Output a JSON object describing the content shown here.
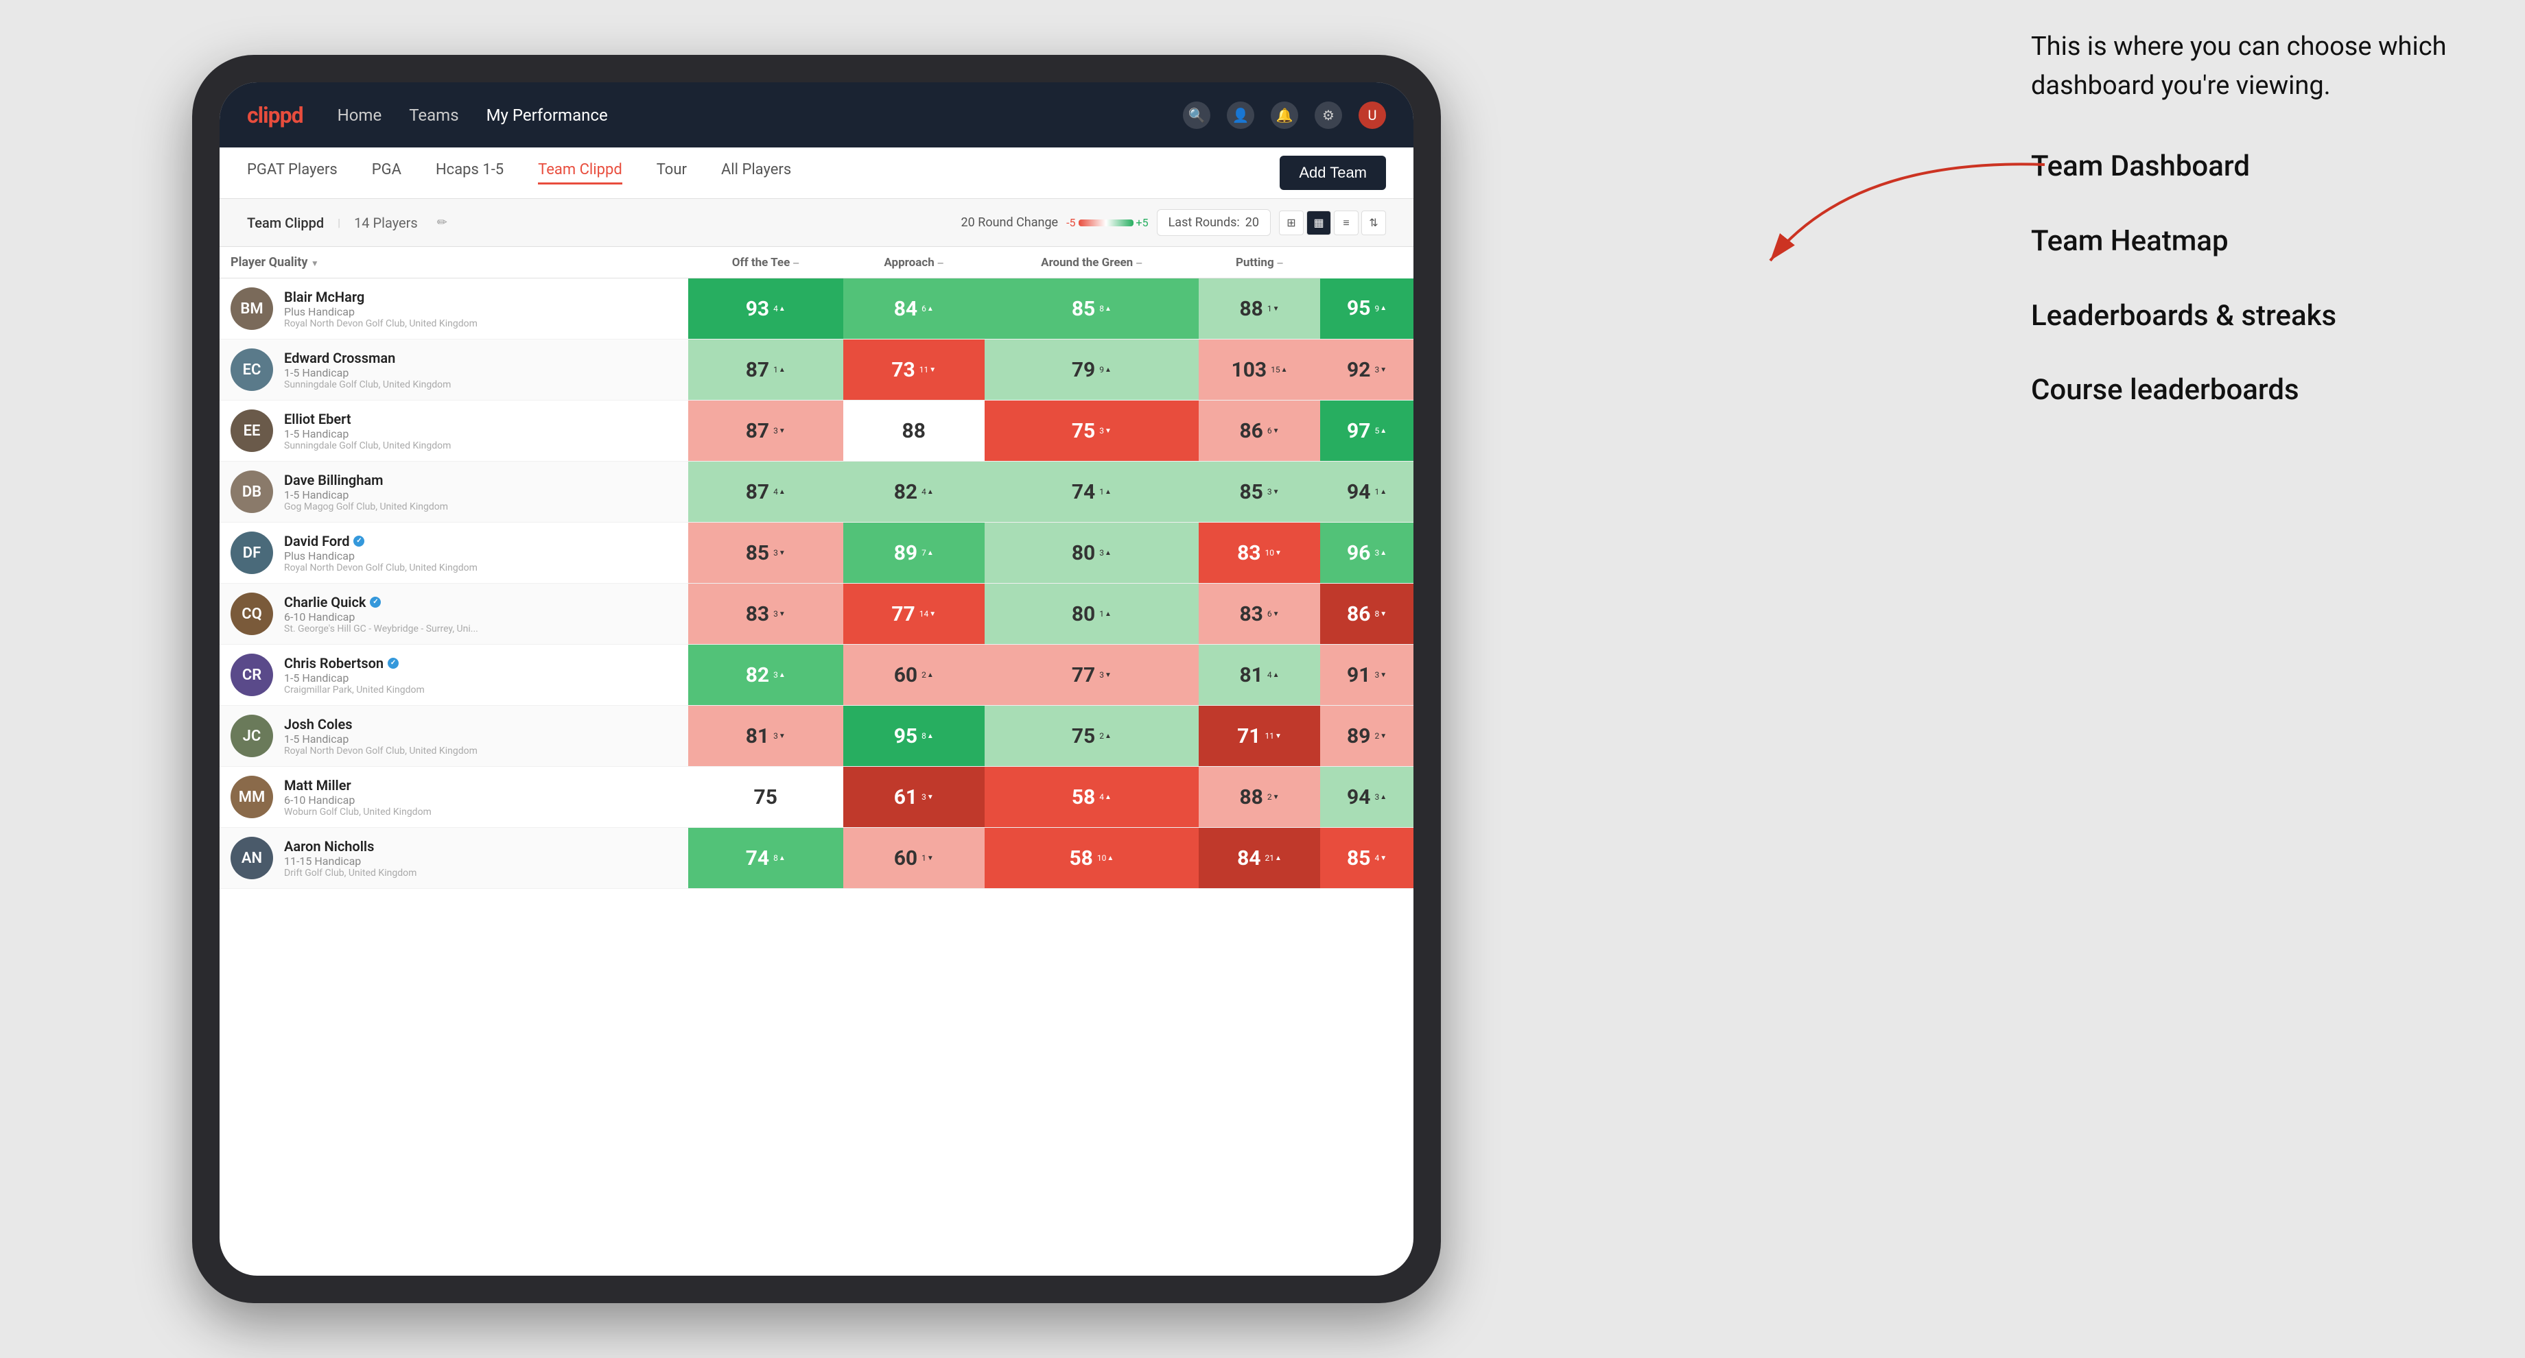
{
  "annotation": {
    "intro": "This is where you can choose which dashboard you're viewing.",
    "items": [
      "Team Dashboard",
      "Team Heatmap",
      "Leaderboards & streaks",
      "Course leaderboards"
    ]
  },
  "nav": {
    "logo": "clippd",
    "links": [
      "Home",
      "Teams",
      "My Performance"
    ],
    "activeLink": "My Performance"
  },
  "tabs": {
    "items": [
      "PGAT Players",
      "PGA",
      "Hcaps 1-5",
      "Team Clippd",
      "Tour",
      "All Players"
    ],
    "active": "Team Clippd",
    "addTeamLabel": "Add Team"
  },
  "controls": {
    "teamName": "Team Clippd",
    "playerCount": "14 Players",
    "roundChangeLabel": "20 Round Change",
    "scaleMin": "-5",
    "scaleMax": "+5",
    "lastRoundsLabel": "Last Rounds:",
    "lastRoundsValue": "20"
  },
  "tableHeaders": {
    "playerQuality": "Player Quality",
    "offTee": "Off the Tee",
    "approach": "Approach",
    "aroundGreen": "Around the Green",
    "putting": "Putting"
  },
  "players": [
    {
      "name": "Blair McHarg",
      "handicap": "Plus Handicap",
      "club": "Royal North Devon Golf Club, United Kingdom",
      "initials": "BM",
      "avatarColor": "#7a6a5a",
      "playerQuality": {
        "score": 93,
        "change": 4,
        "dir": "up",
        "bg": "bg-green-dark"
      },
      "offTee": {
        "score": 84,
        "change": 6,
        "dir": "up",
        "bg": "bg-green-mid"
      },
      "approach": {
        "score": 85,
        "change": 8,
        "dir": "up",
        "bg": "bg-green-mid"
      },
      "aroundGreen": {
        "score": 88,
        "change": 1,
        "dir": "down",
        "bg": "bg-green-light"
      },
      "putting": {
        "score": 95,
        "change": 9,
        "dir": "up",
        "bg": "bg-green-dark"
      }
    },
    {
      "name": "Edward Crossman",
      "handicap": "1-5 Handicap",
      "club": "Sunningdale Golf Club, United Kingdom",
      "initials": "EC",
      "avatarColor": "#5a7a8a",
      "playerQuality": {
        "score": 87,
        "change": 1,
        "dir": "up",
        "bg": "bg-green-light"
      },
      "offTee": {
        "score": 73,
        "change": 11,
        "dir": "down",
        "bg": "bg-red-mid"
      },
      "approach": {
        "score": 79,
        "change": 9,
        "dir": "up",
        "bg": "bg-green-light"
      },
      "aroundGreen": {
        "score": 103,
        "change": 15,
        "dir": "up",
        "bg": "bg-red-light"
      },
      "putting": {
        "score": 92,
        "change": 3,
        "dir": "down",
        "bg": "bg-red-light"
      }
    },
    {
      "name": "Elliot Ebert",
      "handicap": "1-5 Handicap",
      "club": "Sunningdale Golf Club, United Kingdom",
      "initials": "EE",
      "avatarColor": "#6a5a4a",
      "playerQuality": {
        "score": 87,
        "change": 3,
        "dir": "down",
        "bg": "bg-red-light"
      },
      "offTee": {
        "score": 88,
        "change": null,
        "dir": null,
        "bg": "bg-white"
      },
      "approach": {
        "score": 75,
        "change": 3,
        "dir": "down",
        "bg": "bg-red-mid"
      },
      "aroundGreen": {
        "score": 86,
        "change": 6,
        "dir": "down",
        "bg": "bg-red-light"
      },
      "putting": {
        "score": 97,
        "change": 5,
        "dir": "up",
        "bg": "bg-green-dark"
      }
    },
    {
      "name": "Dave Billingham",
      "handicap": "1-5 Handicap",
      "club": "Gog Magog Golf Club, United Kingdom",
      "initials": "DB",
      "avatarColor": "#8a7a6a",
      "playerQuality": {
        "score": 87,
        "change": 4,
        "dir": "up",
        "bg": "bg-green-light"
      },
      "offTee": {
        "score": 82,
        "change": 4,
        "dir": "up",
        "bg": "bg-green-light"
      },
      "approach": {
        "score": 74,
        "change": 1,
        "dir": "up",
        "bg": "bg-green-light"
      },
      "aroundGreen": {
        "score": 85,
        "change": 3,
        "dir": "down",
        "bg": "bg-green-light"
      },
      "putting": {
        "score": 94,
        "change": 1,
        "dir": "up",
        "bg": "bg-green-light"
      }
    },
    {
      "name": "David Ford",
      "handicap": "Plus Handicap",
      "club": "Royal North Devon Golf Club, United Kingdom",
      "initials": "DF",
      "avatarColor": "#4a6a7a",
      "badge": true,
      "playerQuality": {
        "score": 85,
        "change": 3,
        "dir": "down",
        "bg": "bg-red-light"
      },
      "offTee": {
        "score": 89,
        "change": 7,
        "dir": "up",
        "bg": "bg-green-mid"
      },
      "approach": {
        "score": 80,
        "change": 3,
        "dir": "up",
        "bg": "bg-green-light"
      },
      "aroundGreen": {
        "score": 83,
        "change": 10,
        "dir": "down",
        "bg": "bg-red-mid"
      },
      "putting": {
        "score": 96,
        "change": 3,
        "dir": "up",
        "bg": "bg-green-mid"
      }
    },
    {
      "name": "Charlie Quick",
      "handicap": "6-10 Handicap",
      "club": "St. George's Hill GC - Weybridge - Surrey, Uni...",
      "initials": "CQ",
      "avatarColor": "#7a5a3a",
      "badge": true,
      "playerQuality": {
        "score": 83,
        "change": 3,
        "dir": "down",
        "bg": "bg-red-light"
      },
      "offTee": {
        "score": 77,
        "change": 14,
        "dir": "down",
        "bg": "bg-red-mid"
      },
      "approach": {
        "score": 80,
        "change": 1,
        "dir": "up",
        "bg": "bg-green-light"
      },
      "aroundGreen": {
        "score": 83,
        "change": 6,
        "dir": "down",
        "bg": "bg-red-light"
      },
      "putting": {
        "score": 86,
        "change": 8,
        "dir": "down",
        "bg": "bg-red-dark"
      }
    },
    {
      "name": "Chris Robertson",
      "handicap": "1-5 Handicap",
      "club": "Craigmillar Park, United Kingdom",
      "initials": "CR",
      "avatarColor": "#5a4a8a",
      "badge": true,
      "playerQuality": {
        "score": 82,
        "change": 3,
        "dir": "up",
        "bg": "bg-green-mid"
      },
      "offTee": {
        "score": 60,
        "change": 2,
        "dir": "up",
        "bg": "bg-red-light"
      },
      "approach": {
        "score": 77,
        "change": 3,
        "dir": "down",
        "bg": "bg-red-light"
      },
      "aroundGreen": {
        "score": 81,
        "change": 4,
        "dir": "up",
        "bg": "bg-green-light"
      },
      "putting": {
        "score": 91,
        "change": 3,
        "dir": "down",
        "bg": "bg-red-light"
      }
    },
    {
      "name": "Josh Coles",
      "handicap": "1-5 Handicap",
      "club": "Royal North Devon Golf Club, United Kingdom",
      "initials": "JC",
      "avatarColor": "#6a7a5a",
      "playerQuality": {
        "score": 81,
        "change": 3,
        "dir": "down",
        "bg": "bg-red-light"
      },
      "offTee": {
        "score": 95,
        "change": 8,
        "dir": "up",
        "bg": "bg-green-dark"
      },
      "approach": {
        "score": 75,
        "change": 2,
        "dir": "up",
        "bg": "bg-green-light"
      },
      "aroundGreen": {
        "score": 71,
        "change": 11,
        "dir": "down",
        "bg": "bg-red-dark"
      },
      "putting": {
        "score": 89,
        "change": 2,
        "dir": "down",
        "bg": "bg-red-light"
      }
    },
    {
      "name": "Matt Miller",
      "handicap": "6-10 Handicap",
      "club": "Woburn Golf Club, United Kingdom",
      "initials": "MM",
      "avatarColor": "#8a6a4a",
      "playerQuality": {
        "score": 75,
        "change": null,
        "dir": null,
        "bg": "bg-white"
      },
      "offTee": {
        "score": 61,
        "change": 3,
        "dir": "down",
        "bg": "bg-red-dark"
      },
      "approach": {
        "score": 58,
        "change": 4,
        "dir": "up",
        "bg": "bg-red-mid"
      },
      "aroundGreen": {
        "score": 88,
        "change": 2,
        "dir": "down",
        "bg": "bg-red-light"
      },
      "putting": {
        "score": 94,
        "change": 3,
        "dir": "up",
        "bg": "bg-green-light"
      }
    },
    {
      "name": "Aaron Nicholls",
      "handicap": "11-15 Handicap",
      "club": "Drift Golf Club, United Kingdom",
      "initials": "AN",
      "avatarColor": "#4a5a6a",
      "playerQuality": {
        "score": 74,
        "change": 8,
        "dir": "up",
        "bg": "bg-green-mid"
      },
      "offTee": {
        "score": 60,
        "change": 1,
        "dir": "down",
        "bg": "bg-red-light"
      },
      "approach": {
        "score": 58,
        "change": 10,
        "dir": "up",
        "bg": "bg-red-mid"
      },
      "aroundGreen": {
        "score": 84,
        "change": 21,
        "dir": "up",
        "bg": "bg-red-dark"
      },
      "putting": {
        "score": 85,
        "change": 4,
        "dir": "down",
        "bg": "bg-red-mid"
      }
    }
  ]
}
